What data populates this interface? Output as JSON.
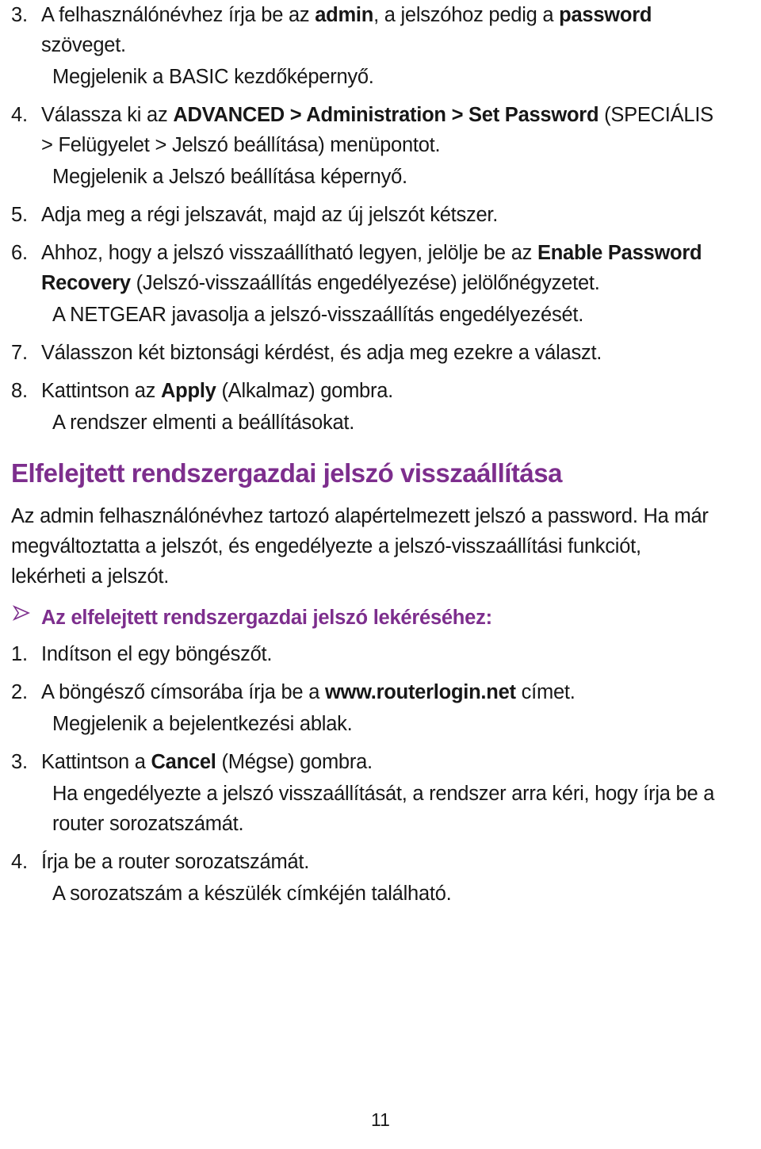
{
  "document": {
    "language": "hu",
    "accent_color": "#7d2e8d",
    "text_color": "#171717",
    "page_number": "11"
  },
  "steps_top": [
    {
      "number": "3.",
      "text_parts": [
        {
          "text": "A felhasználónévhez írja be az ",
          "bold": false
        },
        {
          "text": "admin",
          "bold": true
        },
        {
          "text": ", a jelszóhoz pedig a ",
          "bold": false
        },
        {
          "text": "password",
          "bold": true
        },
        {
          "text": " szöveget.",
          "bold": false
        }
      ],
      "note": "Megjelenik a BASIC kezdőképernyő."
    },
    {
      "number": "4.",
      "text_parts": [
        {
          "text": "Válassza ki az ",
          "bold": false
        },
        {
          "text": "ADVANCED > Administration > Set Password",
          "bold": true
        },
        {
          "text": " (SPECIÁLIS > Felügyelet > Jelszó beállítása) menüpontot.",
          "bold": false
        }
      ],
      "note": "Megjelenik a Jelszó beállítása képernyő."
    },
    {
      "number": "5.",
      "text_parts": [
        {
          "text": "Adja meg a régi jelszavát, majd az új jelszót kétszer.",
          "bold": false
        }
      ],
      "note": ""
    },
    {
      "number": "6.",
      "text_parts": [
        {
          "text": "Ahhoz, hogy a jelszó visszaállítható legyen, jelölje be az ",
          "bold": false
        },
        {
          "text": "Enable Password Recovery",
          "bold": true
        },
        {
          "text": " (Jelszó-visszaállítás engedélyezése) jelölőnégyzetet.",
          "bold": false
        }
      ],
      "note": "A NETGEAR javasolja a jelszó-visszaállítás engedélyezését."
    },
    {
      "number": "7.",
      "text_parts": [
        {
          "text": "Válasszon két biztonsági kérdést, és adja meg ezekre a választ.",
          "bold": false
        }
      ],
      "note": ""
    },
    {
      "number": "8.",
      "text_parts": [
        {
          "text": "Kattintson az ",
          "bold": false
        },
        {
          "text": "Apply",
          "bold": true
        },
        {
          "text": " (Alkalmaz) gombra.",
          "bold": false
        }
      ],
      "note": "A rendszer elmenti a beállításokat."
    }
  ],
  "section": {
    "heading": "Elfelejtett rendszergazdai jelszó visszaállítása",
    "paragraph": "Az admin felhasználónévhez tartozó alapértelmezett jelszó a password. Ha már megváltoztatta a jelszót, és engedélyezte a jelszó-visszaállítási funkciót, lekérheti a jelszót.",
    "arrow_icon": "arrow-right-outline-icon",
    "arrow_heading": "Az elfelejtett rendszergazdai jelszó lekéréséhez:"
  },
  "steps_bottom": [
    {
      "number": "1.",
      "text_parts": [
        {
          "text": "Indítson el egy böngészőt.",
          "bold": false
        }
      ],
      "note": ""
    },
    {
      "number": "2.",
      "text_parts": [
        {
          "text": "A böngésző címsorába írja be a ",
          "bold": false
        },
        {
          "text": "www.routerlogin.net",
          "bold": true
        },
        {
          "text": " címet.",
          "bold": false
        }
      ],
      "note": "Megjelenik a bejelentkezési ablak."
    },
    {
      "number": "3.",
      "text_parts": [
        {
          "text": "Kattintson a ",
          "bold": false
        },
        {
          "text": "Cancel",
          "bold": true
        },
        {
          "text": " (Mégse) gombra.",
          "bold": false
        }
      ],
      "note": "Ha engedélyezte a jelszó visszaállítását, a rendszer arra kéri, hogy írja be a router sorozatszámát."
    },
    {
      "number": "4.",
      "text_parts": [
        {
          "text": "Írja be a router sorozatszámát.",
          "bold": false
        }
      ],
      "note": "A sorozatszám a készülék címkéjén található."
    }
  ]
}
